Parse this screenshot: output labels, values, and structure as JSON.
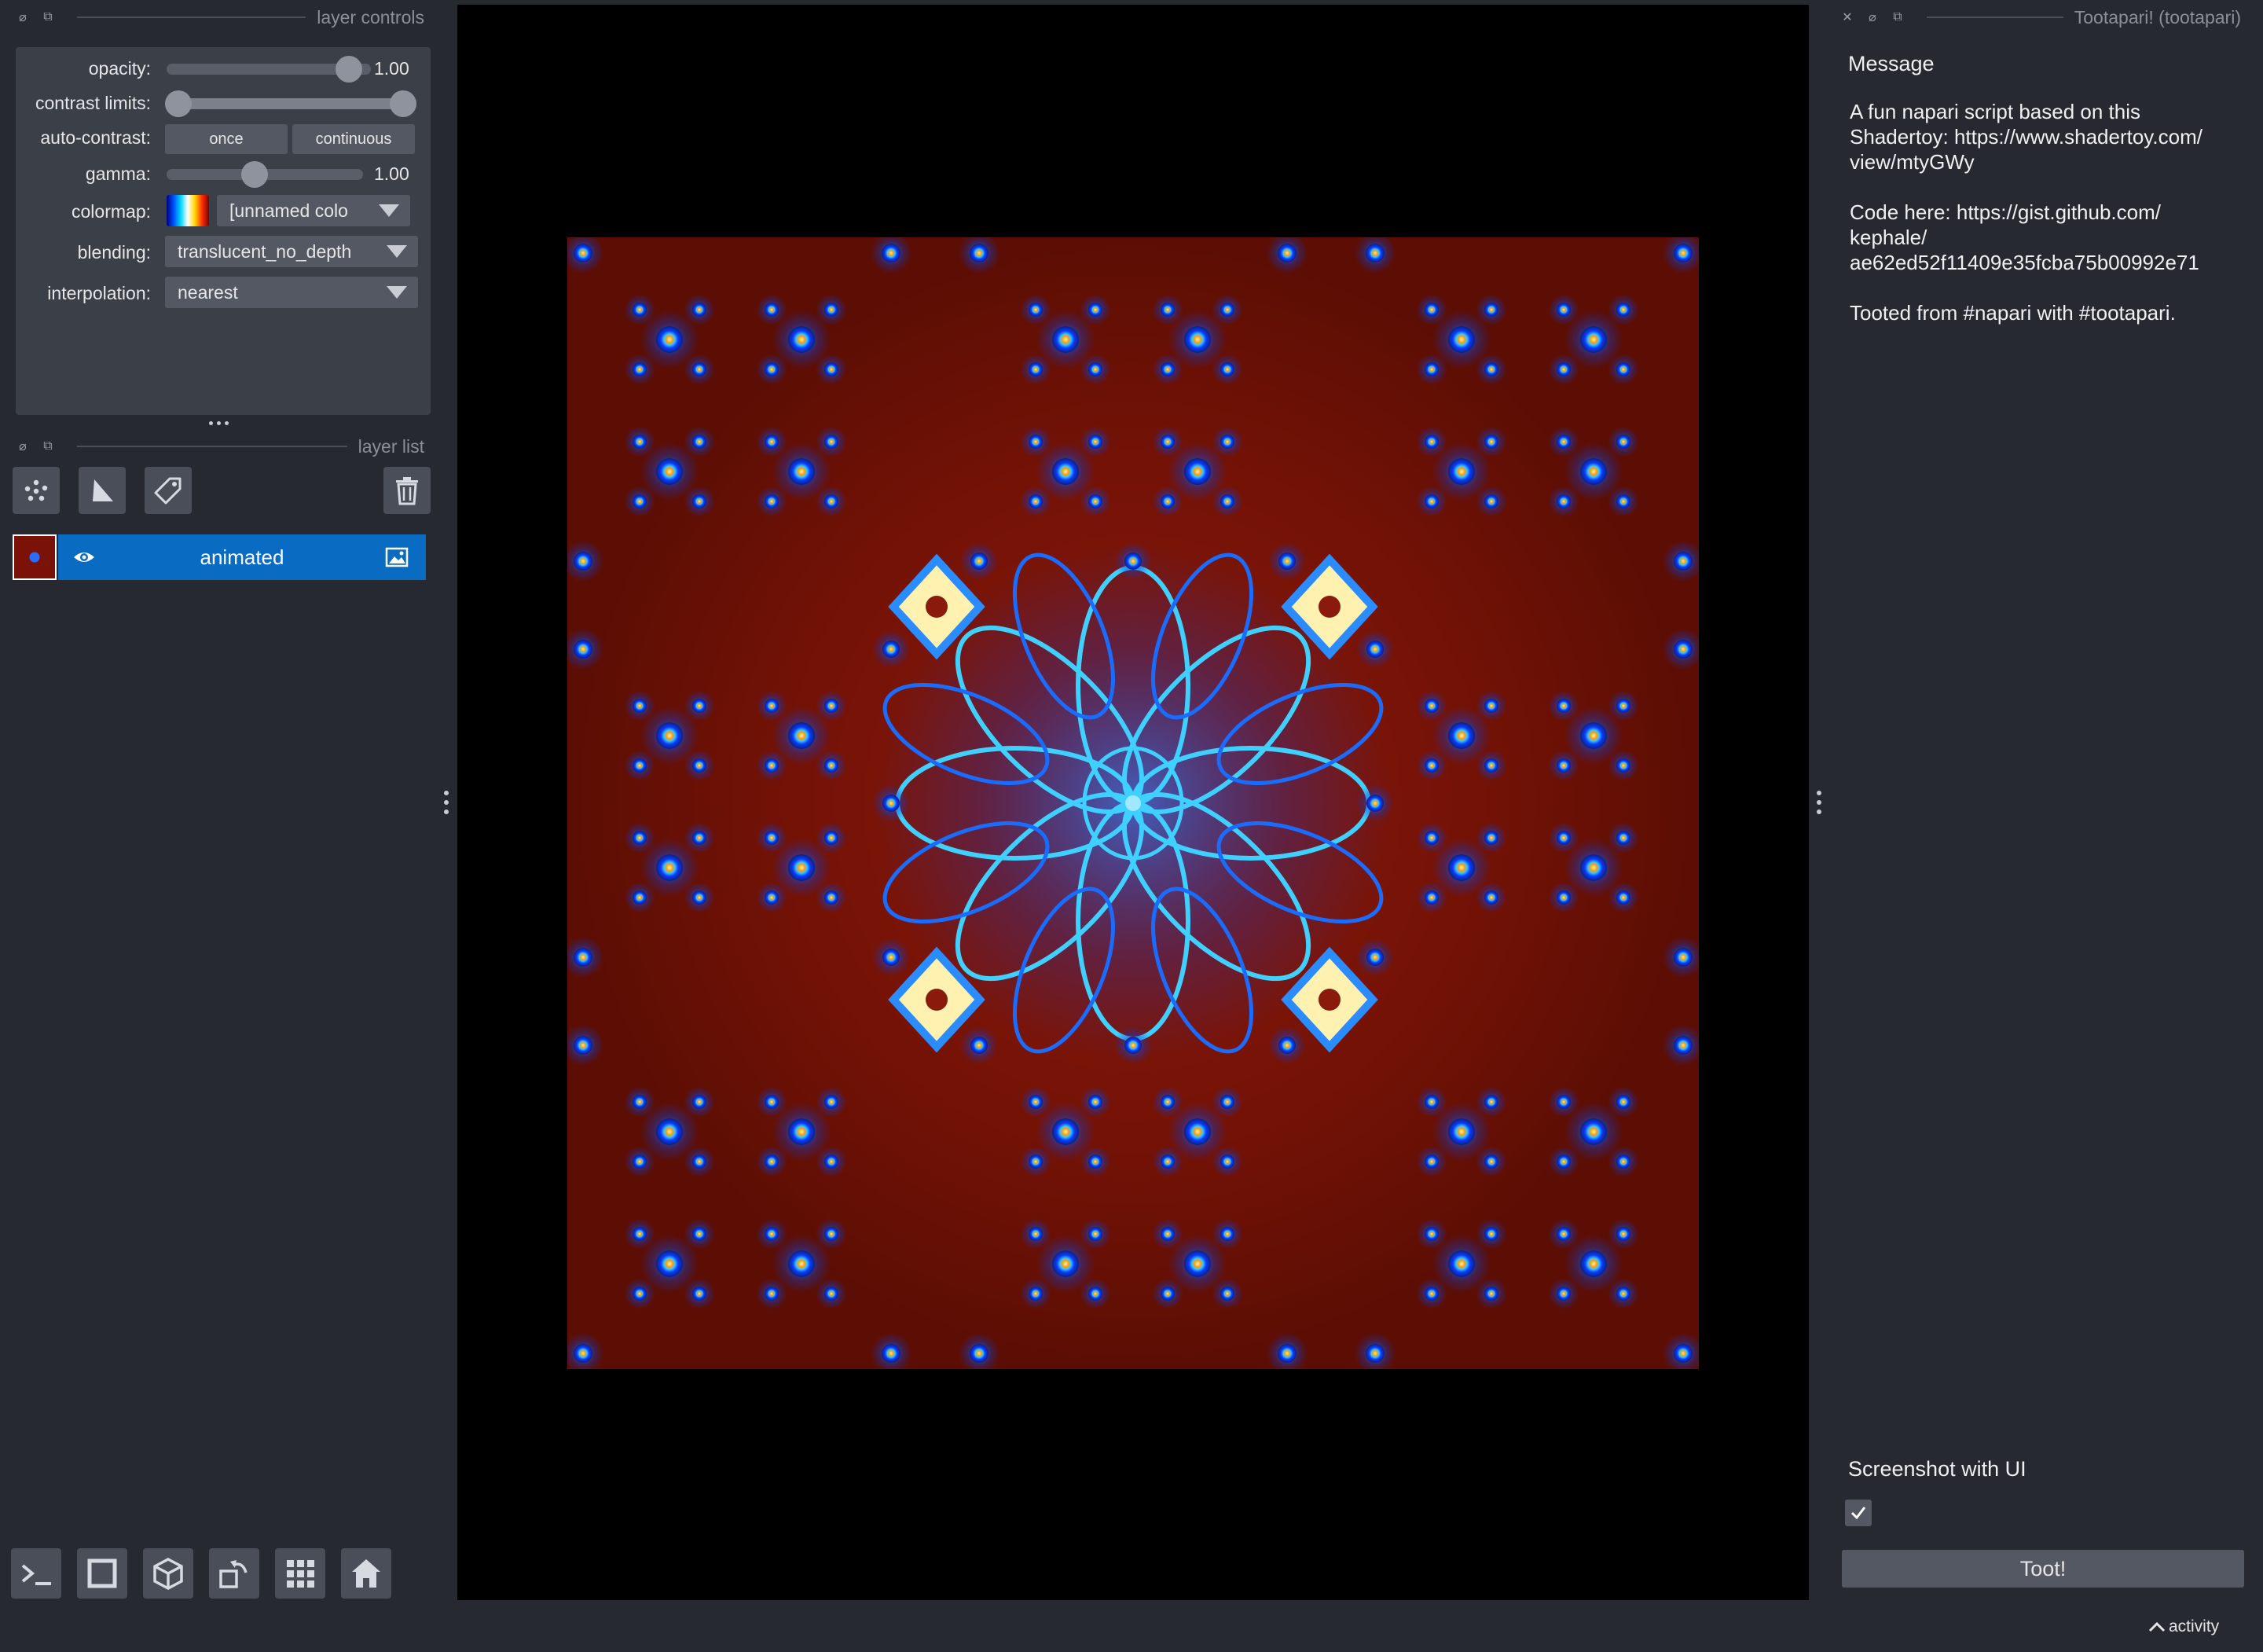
{
  "layer_controls": {
    "title": "layer controls",
    "opacity": {
      "label": "opacity:",
      "value": "1.00",
      "level": 1.0
    },
    "contrast_limits": {
      "label": "contrast limits:",
      "low": 0.0,
      "high": 1.0
    },
    "auto_contrast": {
      "label": "auto-contrast:",
      "once": "once",
      "continuous": "continuous"
    },
    "gamma": {
      "label": "gamma:",
      "value": "1.00",
      "level": 0.5
    },
    "colormap": {
      "label": "colormap:",
      "value": "[unnamed colo"
    },
    "blending": {
      "label": "blending:",
      "value": "translucent_no_depth"
    },
    "interpolation": {
      "label": "interpolation:",
      "value": "nearest"
    }
  },
  "layer_list": {
    "title": "layer list",
    "layers": [
      {
        "name": "animated",
        "visible": true,
        "type_icon": "image-icon"
      }
    ]
  },
  "tools": [
    "points-icon",
    "shapes-icon",
    "labels-icon",
    "trash-icon"
  ],
  "bottom_toolbar": [
    "console-icon",
    "ndisplay-square-icon",
    "3d-cube-icon",
    "roll-icon",
    "grid-icon",
    "home-icon"
  ],
  "right_panel": {
    "title": "Tootapari! (tootapari)",
    "message_label": "Message",
    "message_lines": [
      "A fun napari script based on this",
      "Shadertoy: https://www.shadertoy.com/",
      "view/mtyGWy",
      "",
      "Code here: https://gist.github.com/",
      "kephale/",
      "ae62ed52f11409e35fcba75b00992e71",
      "",
      "Tooted from #napari with #tootapari."
    ],
    "screenshot_label": "Screenshot with UI",
    "screenshot_checked": true,
    "toot_button": "Toot!"
  },
  "status": {
    "activity": "activity"
  },
  "colors": {
    "background": "#262930",
    "panel": "#3b3f47",
    "selected_layer": "#0a6bc2",
    "canvas": "#000000",
    "fractal_base": "#7a1208"
  }
}
